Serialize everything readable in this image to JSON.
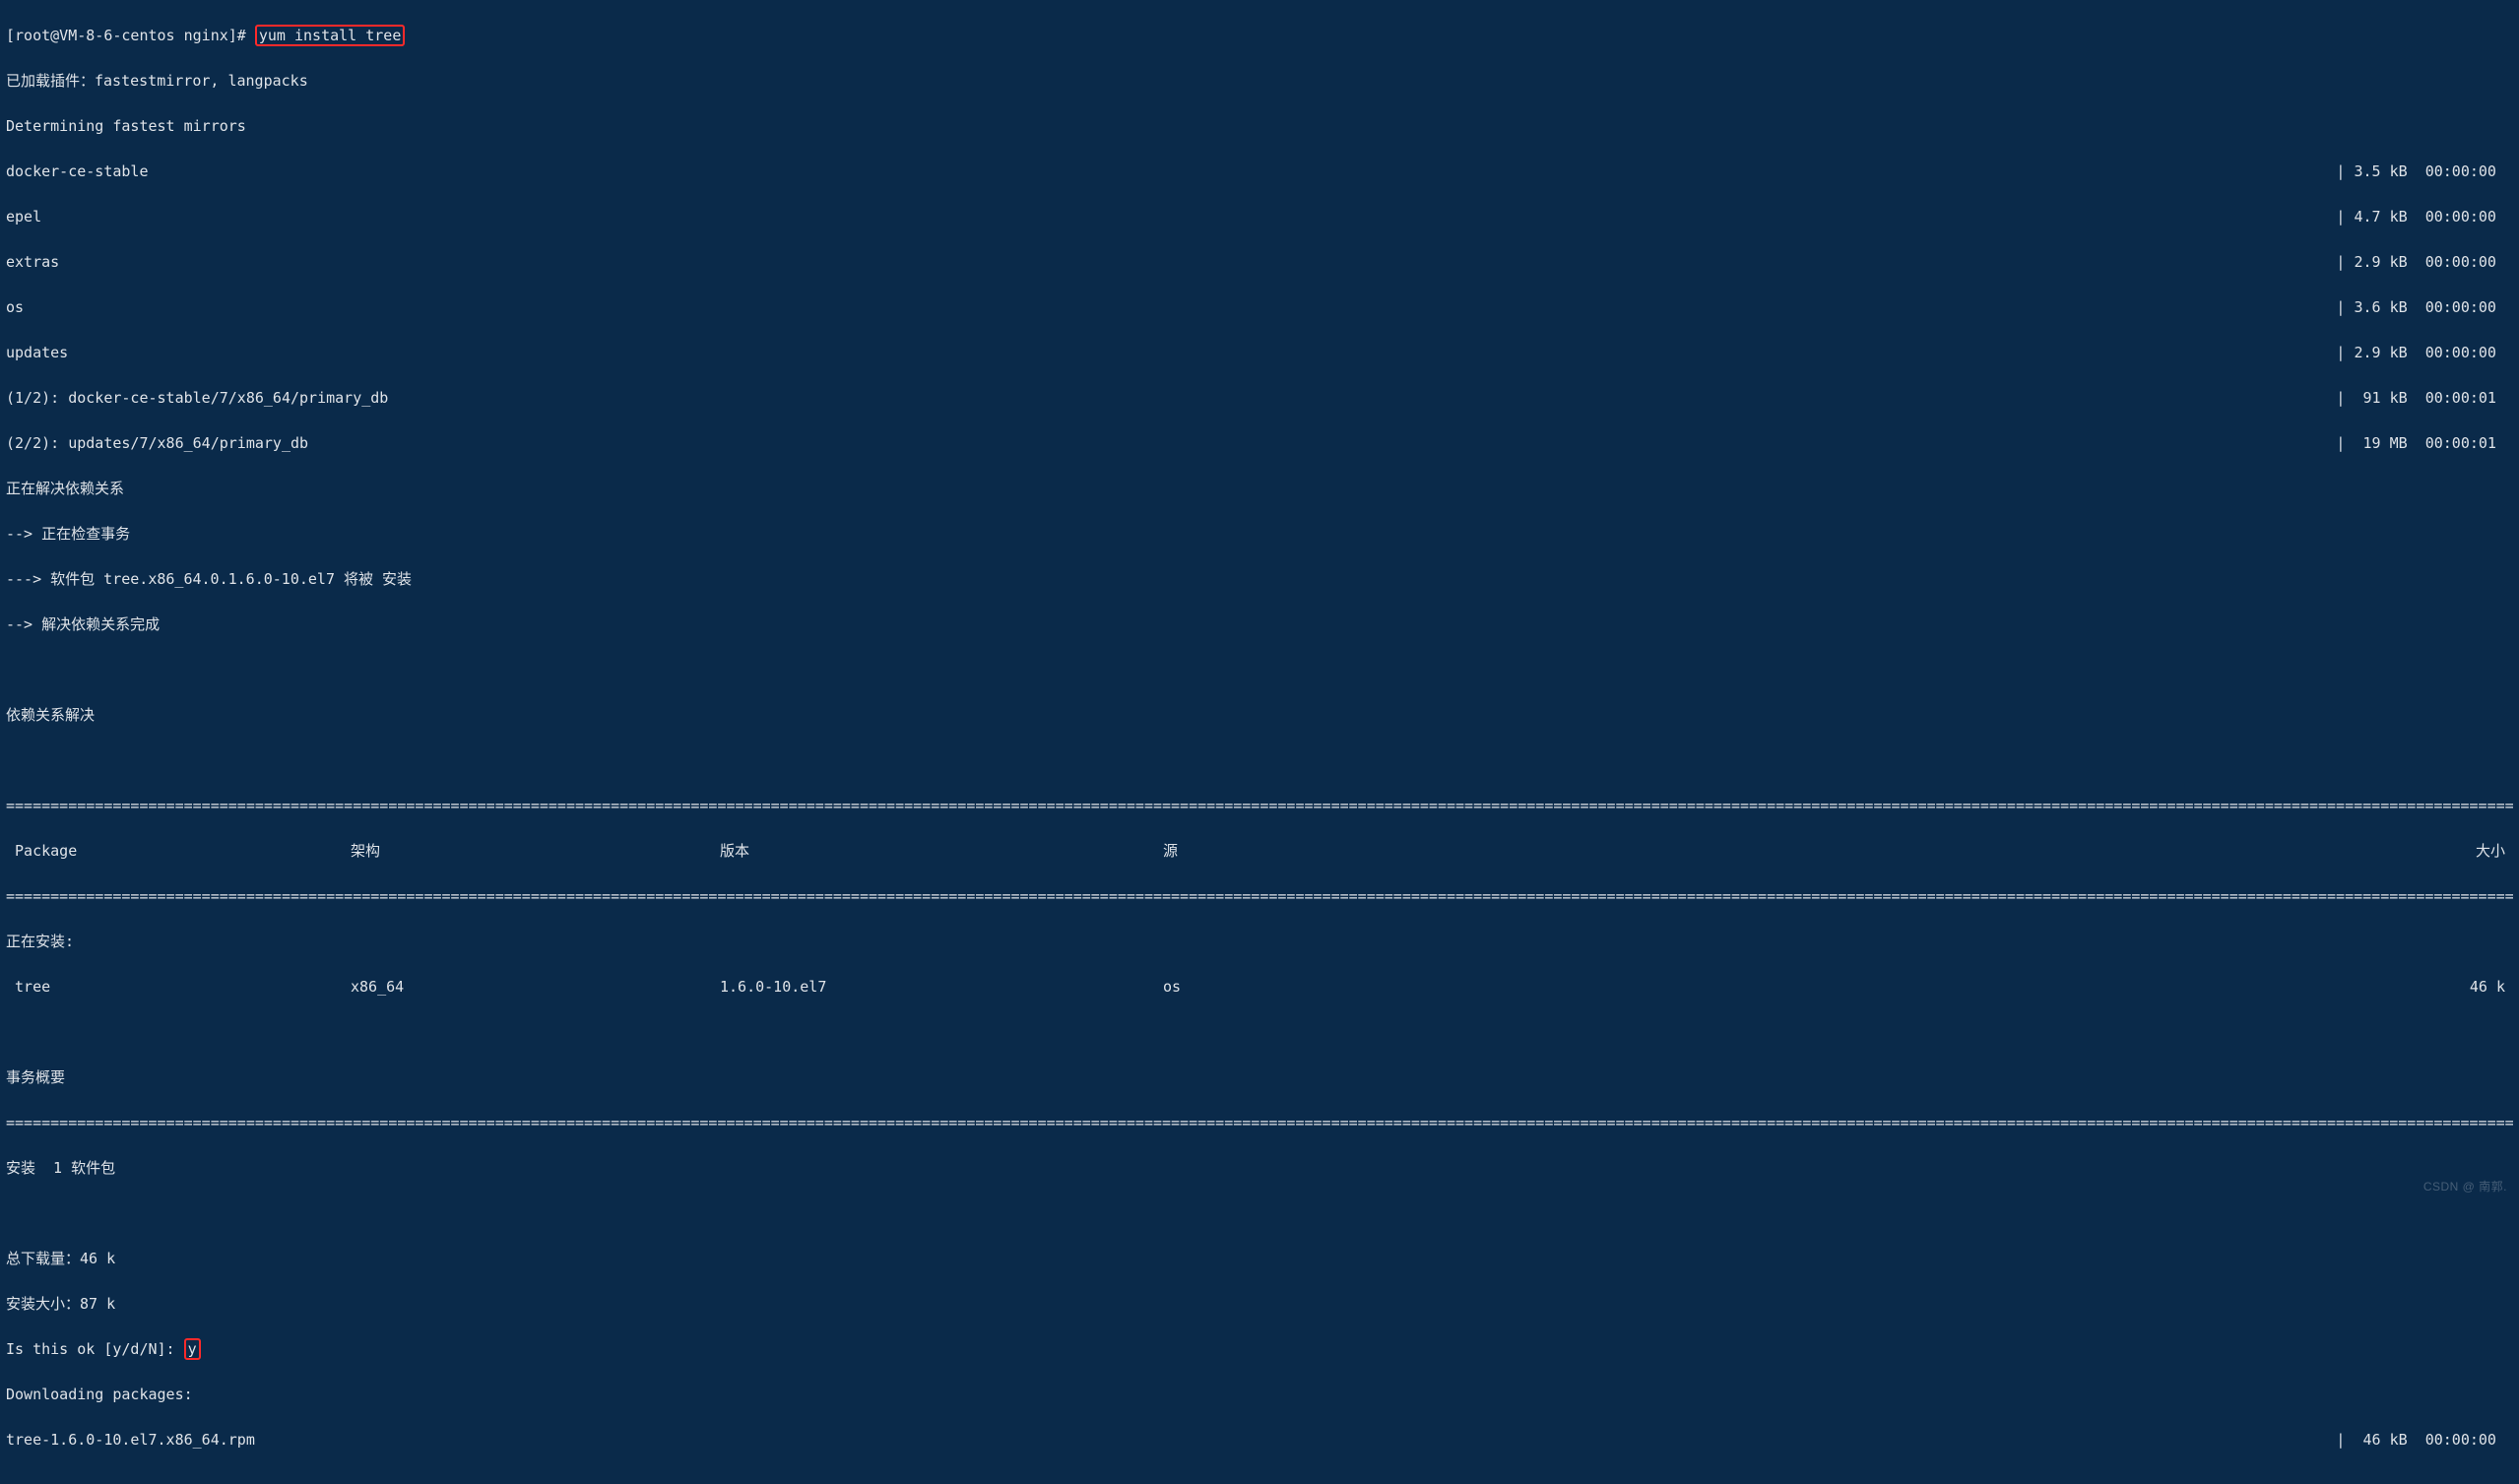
{
  "prompt": {
    "prefix": "[root@VM-8-6-centos nginx]# ",
    "command": "yum install tree"
  },
  "plugins_line": "已加载插件：fastestmirror, langpacks",
  "determining": "Determining fastest mirrors",
  "repos": [
    {
      "name": "docker-ce-stable",
      "size": "3.5 kB",
      "time": "00:00:00"
    },
    {
      "name": "epel",
      "size": "4.7 kB",
      "time": "00:00:00"
    },
    {
      "name": "extras",
      "size": "2.9 kB",
      "time": "00:00:00"
    },
    {
      "name": "os",
      "size": "3.6 kB",
      "time": "00:00:00"
    },
    {
      "name": "updates",
      "size": "2.9 kB",
      "time": "00:00:00"
    }
  ],
  "fetches": [
    {
      "label": "(1/2): docker-ce-stable/7/x86_64/primary_db",
      "size": " 91 kB",
      "time": "00:00:01"
    },
    {
      "label": "(2/2): updates/7/x86_64/primary_db",
      "size": " 19 MB",
      "time": "00:00:01"
    }
  ],
  "dep": {
    "resolving": "正在解决依赖关系",
    "check": "--> 正在检查事务",
    "pkg": "---> 软件包 tree.x86_64.0.1.6.0-10.el7 将被 安装",
    "done": "--> 解决依赖关系完成",
    "resolved": "依赖关系解决"
  },
  "table": {
    "headers": {
      "package": " Package",
      "arch": "架构",
      "version": "版本",
      "repo": "源",
      "size": "大小"
    },
    "installing_label": "正在安装:",
    "row": {
      "package": " tree",
      "arch": "x86_64",
      "version": "1.6.0-10.el7",
      "repo": "os",
      "size": "46 k"
    }
  },
  "summary": {
    "title": "事务概要",
    "install": "安装  1 软件包",
    "dl_total": "总下载量：46 k",
    "install_size": "安装大小：87 k"
  },
  "confirm": {
    "question": "Is this ok [y/d/N]: ",
    "answer": "y"
  },
  "download": {
    "label": "Downloading packages:",
    "rpm": "tree-1.6.0-10.el7.x86_64.rpm",
    "size": " 46 kB",
    "time": "00:00:00"
  },
  "watermark": "CSDN @ 南郭."
}
